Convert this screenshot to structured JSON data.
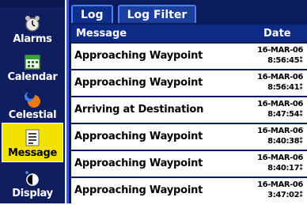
{
  "nav": {
    "items": [
      {
        "label": "Alarms",
        "icon": "alarm-clock-icon"
      },
      {
        "label": "Calendar",
        "icon": "calendar-icon"
      },
      {
        "label": "Celestial",
        "icon": "sun-moon-icon"
      },
      {
        "label": "Message",
        "icon": "message-log-icon"
      },
      {
        "label": "Display",
        "icon": "display-contrast-icon"
      }
    ],
    "active_index": 3
  },
  "tabs": [
    {
      "label": "Log"
    },
    {
      "label": "Log Filter"
    }
  ],
  "table": {
    "headers": {
      "message": "Message",
      "date": "Date"
    },
    "rows": [
      {
        "message": "Approaching Waypoint",
        "date": "16-MAR-06",
        "time": "8:56:45⁑"
      },
      {
        "message": "Approaching Waypoint",
        "date": "16-MAR-06",
        "time": "8:56:41⁑"
      },
      {
        "message": "Arriving at Destination",
        "date": "16-MAR-06",
        "time": "8:47:54⁑"
      },
      {
        "message": "Approaching Waypoint",
        "date": "16-MAR-06",
        "time": "8:40:38⁑"
      },
      {
        "message": "Approaching Waypoint",
        "date": "16-MAR-06",
        "time": "8:40:17⁑"
      },
      {
        "message": "Approaching Waypoint",
        "date": "16-MAR-06",
        "time": "3:47:02⁑"
      }
    ]
  },
  "colors": {
    "nav_bg": "#0e1e5e",
    "active_bg": "#f3e100",
    "panel_bg": "#0b1c5c",
    "tab_border": "#4d7ef0"
  }
}
